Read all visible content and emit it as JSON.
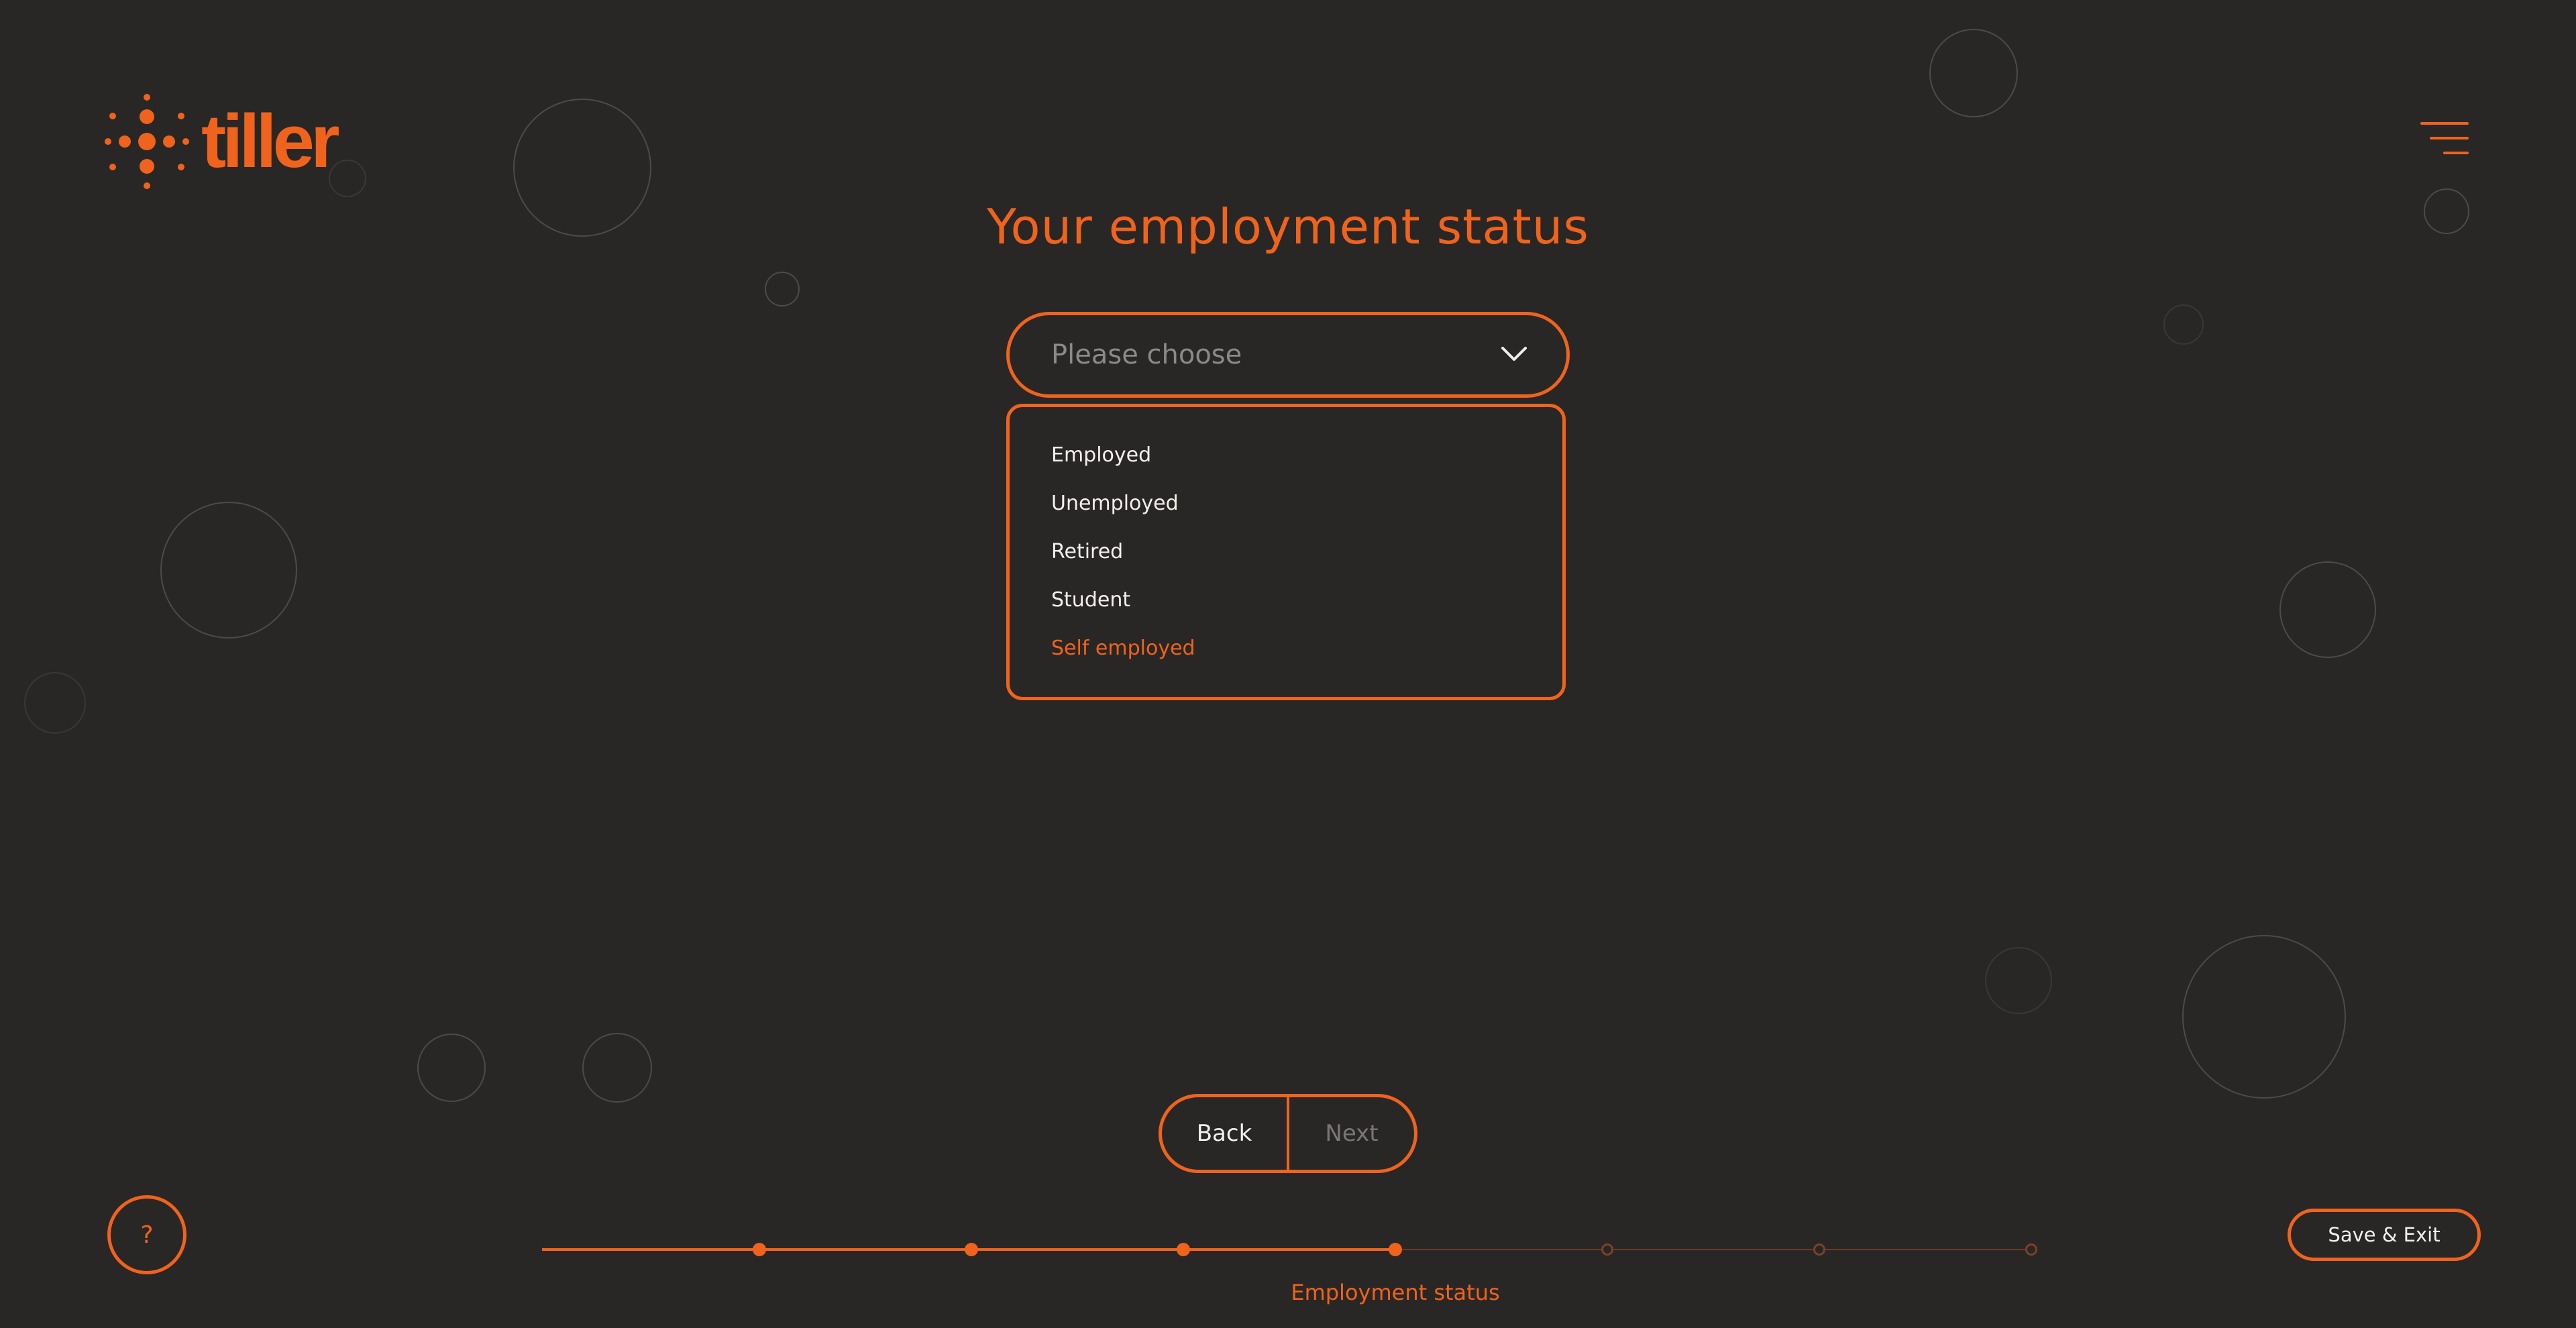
{
  "brand": {
    "name": "tiller",
    "logo_icon": "tiller-spark-icon",
    "accent": "#f0631c",
    "background": "#292726"
  },
  "header": {
    "menu_icon": "hamburger-menu-icon"
  },
  "main": {
    "title": "Your employment status",
    "select": {
      "placeholder": "Please choose",
      "icon": "chevron-down-icon",
      "open": true,
      "options": [
        {
          "label": "Employed",
          "highlighted": false
        },
        {
          "label": "Unemployed",
          "highlighted": false
        },
        {
          "label": "Retired",
          "highlighted": false
        },
        {
          "label": "Student",
          "highlighted": false
        },
        {
          "label": "Self employed",
          "highlighted": true
        }
      ]
    }
  },
  "nav": {
    "back_label": "Back",
    "next_label": "Next",
    "next_enabled": false
  },
  "footer": {
    "help_label": "?",
    "save_exit_label": "Save & Exit",
    "progress": {
      "total_steps": 7,
      "completed_steps": 4,
      "current_step_label": "Employment status"
    }
  }
}
